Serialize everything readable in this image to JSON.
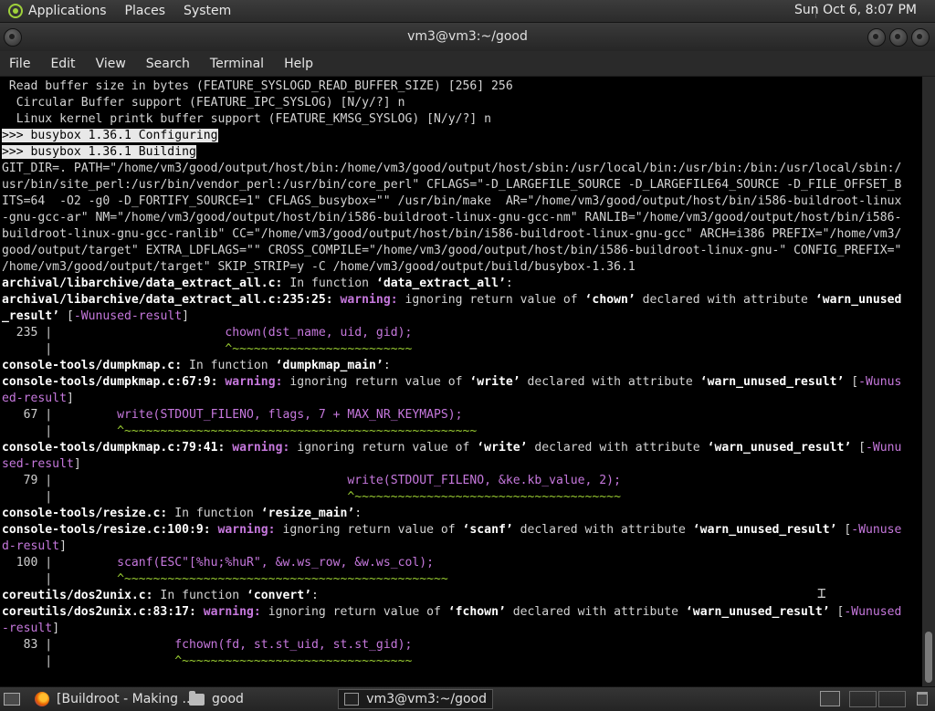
{
  "top_panel": {
    "menus": [
      "Applications",
      "Places",
      "System"
    ],
    "clock": "Sun Oct  6,  8:07 PM"
  },
  "window": {
    "title": "vm3@vm3:~/good",
    "menu": [
      "File",
      "Edit",
      "View",
      "Search",
      "Terminal",
      "Help"
    ]
  },
  "terminal": {
    "lines": [
      [
        [
          "n",
          " Read buffer size in bytes (FEATURE_SYSLOGD_READ_BUFFER_SIZE) [256] 256"
        ]
      ],
      [
        [
          "n",
          "  Circular Buffer support (FEATURE_IPC_SYSLOG) [N/y/?] n"
        ]
      ],
      [
        [
          "n",
          "  Linux kernel printk buffer support (FEATURE_KMSG_SYSLOG) [N/y/?] n"
        ]
      ],
      [
        [
          "h",
          ">>> busybox 1.36.1 Configuring"
        ]
      ],
      [
        [
          "h",
          ">>> busybox 1.36.1 Building"
        ]
      ],
      [
        [
          "n",
          "GIT_DIR=. PATH=\"/home/vm3/good/output/host/bin:/home/vm3/good/output/host/sbin:/usr/local/bin:/usr/bin:/bin:/usr/local/sbin:/"
        ]
      ],
      [
        [
          "n",
          "usr/bin/site_perl:/usr/bin/vendor_perl:/usr/bin/core_perl\" CFLAGS=\"-D_LARGEFILE_SOURCE -D_LARGEFILE64_SOURCE -D_FILE_OFFSET_B"
        ]
      ],
      [
        [
          "n",
          "ITS=64  -O2 -g0 -D_FORTIFY_SOURCE=1\" CFLAGS_busybox=\"\" /usr/bin/make  AR=\"/home/vm3/good/output/host/bin/i586-buildroot-linux"
        ]
      ],
      [
        [
          "n",
          "-gnu-gcc-ar\" NM=\"/home/vm3/good/output/host/bin/i586-buildroot-linux-gnu-gcc-nm\" RANLIB=\"/home/vm3/good/output/host/bin/i586-"
        ]
      ],
      [
        [
          "n",
          "buildroot-linux-gnu-gcc-ranlib\" CC=\"/home/vm3/good/output/host/bin/i586-buildroot-linux-gnu-gcc\" ARCH=i386 PREFIX=\"/home/vm3/"
        ]
      ],
      [
        [
          "n",
          "good/output/target\" EXTRA_LDFLAGS=\"\" CROSS_COMPILE=\"/home/vm3/good/output/host/bin/i586-buildroot-linux-gnu-\" CONFIG_PREFIX=\""
        ]
      ],
      [
        [
          "n",
          "/home/vm3/good/output/target\" SKIP_STRIP=y -C /home/vm3/good/output/build/busybox-1.36.1"
        ]
      ],
      [
        [
          "b",
          "archival/libarchive/data_extract_all.c:"
        ],
        [
          "n",
          " In function "
        ],
        [
          "b",
          "‘data_extract_all’"
        ],
        [
          "n",
          ":"
        ]
      ],
      [
        [
          "b",
          "archival/libarchive/data_extract_all.c:235:25: "
        ],
        [
          "w",
          "warning: "
        ],
        [
          "n",
          "ignoring return value of "
        ],
        [
          "b",
          "‘chown’"
        ],
        [
          "n",
          " declared with attribute "
        ],
        [
          "b",
          "‘warn_unused"
        ]
      ],
      [
        [
          "b",
          "_result’"
        ],
        [
          "n",
          " ["
        ],
        [
          "o",
          "-Wunused-result"
        ],
        [
          "n",
          "]"
        ]
      ],
      [
        [
          "g",
          "  235 |                        "
        ],
        [
          "o",
          "chown(dst_name, uid, gid);"
        ]
      ],
      [
        [
          "g",
          "      |                        "
        ],
        [
          "c",
          "^~~~~~~~~~~~~~~~~~~~~~~~~~"
        ]
      ],
      [
        [
          "b",
          "console-tools/dumpkmap.c:"
        ],
        [
          "n",
          " In function "
        ],
        [
          "b",
          "‘dumpkmap_main’"
        ],
        [
          "n",
          ":"
        ]
      ],
      [
        [
          "b",
          "console-tools/dumpkmap.c:67:9: "
        ],
        [
          "w",
          "warning: "
        ],
        [
          "n",
          "ignoring return value of "
        ],
        [
          "b",
          "‘write’"
        ],
        [
          "n",
          " declared with attribute "
        ],
        [
          "b",
          "‘warn_unused_result’"
        ],
        [
          "n",
          " ["
        ],
        [
          "o",
          "-Wunus"
        ]
      ],
      [
        [
          "o",
          "ed-result"
        ],
        [
          "n",
          "]"
        ]
      ],
      [
        [
          "g",
          "   67 |         "
        ],
        [
          "o",
          "write(STDOUT_FILENO, flags, 7 + MAX_NR_KEYMAPS);"
        ]
      ],
      [
        [
          "g",
          "      |         "
        ],
        [
          "c",
          "^~~~~~~~~~~~~~~~~~~~~~~~~~~~~~~~~~~~~~~~~~~~~~~~~~"
        ]
      ],
      [
        [
          "b",
          "console-tools/dumpkmap.c:79:41: "
        ],
        [
          "w",
          "warning: "
        ],
        [
          "n",
          "ignoring return value of "
        ],
        [
          "b",
          "‘write’"
        ],
        [
          "n",
          " declared with attribute "
        ],
        [
          "b",
          "‘warn_unused_result’"
        ],
        [
          "n",
          " ["
        ],
        [
          "o",
          "-Wunu"
        ]
      ],
      [
        [
          "o",
          "sed-result"
        ],
        [
          "n",
          "]"
        ]
      ],
      [
        [
          "g",
          "   79 |                                         "
        ],
        [
          "o",
          "write(STDOUT_FILENO, &ke.kb_value, 2);"
        ]
      ],
      [
        [
          "g",
          "      |                                         "
        ],
        [
          "c",
          "^~~~~~~~~~~~~~~~~~~~~~~~~~~~~~~~~~~~~~"
        ]
      ],
      [
        [
          "b",
          "console-tools/resize.c:"
        ],
        [
          "n",
          " In function "
        ],
        [
          "b",
          "‘resize_main’"
        ],
        [
          "n",
          ":"
        ]
      ],
      [
        [
          "b",
          "console-tools/resize.c:100:9: "
        ],
        [
          "w",
          "warning: "
        ],
        [
          "n",
          "ignoring return value of "
        ],
        [
          "b",
          "‘scanf’"
        ],
        [
          "n",
          " declared with attribute "
        ],
        [
          "b",
          "‘warn_unused_result’"
        ],
        [
          "n",
          " ["
        ],
        [
          "o",
          "-Wunuse"
        ]
      ],
      [
        [
          "o",
          "d-result"
        ],
        [
          "n",
          "]"
        ]
      ],
      [
        [
          "g",
          "  100 |         "
        ],
        [
          "o",
          "scanf(ESC\"[%hu;%huR\", &w.ws_row, &w.ws_col);"
        ]
      ],
      [
        [
          "g",
          "      |         "
        ],
        [
          "c",
          "^~~~~~~~~~~~~~~~~~~~~~~~~~~~~~~~~~~~~~~~~~~~~~"
        ]
      ],
      [
        [
          "b",
          "coreutils/dos2unix.c:"
        ],
        [
          "n",
          " In function "
        ],
        [
          "b",
          "‘convert’"
        ],
        [
          "n",
          ":"
        ]
      ],
      [
        [
          "b",
          "coreutils/dos2unix.c:83:17: "
        ],
        [
          "w",
          "warning: "
        ],
        [
          "n",
          "ignoring return value of "
        ],
        [
          "b",
          "‘fchown’"
        ],
        [
          "n",
          " declared with attribute "
        ],
        [
          "b",
          "‘warn_unused_result’"
        ],
        [
          "n",
          " ["
        ],
        [
          "o",
          "-Wunused"
        ]
      ],
      [
        [
          "o",
          "-result"
        ],
        [
          "n",
          "]"
        ]
      ],
      [
        [
          "g",
          "   83 |                 "
        ],
        [
          "o",
          "fchown(fd, st.st_uid, st.st_gid);"
        ]
      ],
      [
        [
          "g",
          "      |                 "
        ],
        [
          "c",
          "^~~~~~~~~~~~~~~~~~~~~~~~~~~~~~~~~"
        ]
      ]
    ]
  },
  "taskbar": {
    "tasks": [
      {
        "label": "[Buildroot - Making ...",
        "icon": "firefox-icon"
      },
      {
        "label": "good",
        "icon": "folder-icon"
      },
      {
        "label": "vm3@vm3:~/good",
        "icon": "terminal-icon"
      }
    ]
  },
  "colors": {
    "terminal_bg": "#000000",
    "terminal_fg": "#d4d4d4",
    "warning": "#c678dd",
    "caret": "#9acd32"
  }
}
